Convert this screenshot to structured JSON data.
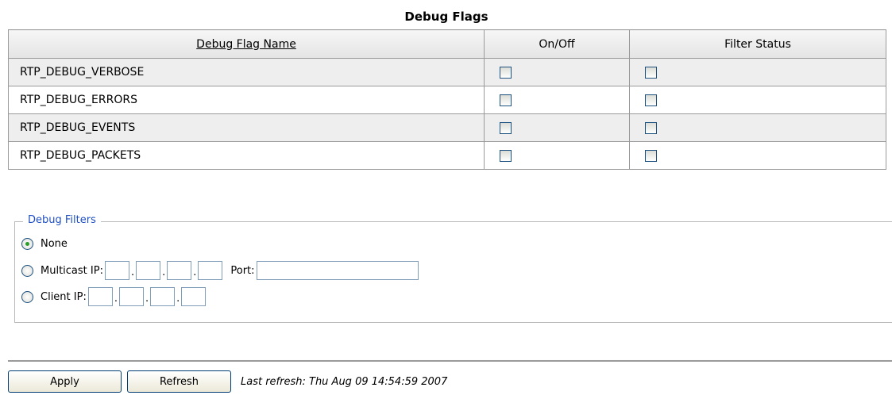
{
  "flags": {
    "title": "Debug Flags",
    "columns": [
      "Debug Flag Name",
      "On/Off",
      "Filter Status"
    ],
    "rows": [
      {
        "name": "RTP_DEBUG_VERBOSE",
        "on": false,
        "filter": false
      },
      {
        "name": "RTP_DEBUG_ERRORS",
        "on": false,
        "filter": false
      },
      {
        "name": "RTP_DEBUG_EVENTS",
        "on": false,
        "filter": false
      },
      {
        "name": "RTP_DEBUG_PACKETS",
        "on": false,
        "filter": false
      }
    ]
  },
  "filters": {
    "legend": "Debug Filters",
    "options": {
      "none": {
        "label": "None",
        "selected": true
      },
      "multicast": {
        "label": "Multicast IP:",
        "port_label": "Port:",
        "selected": false
      },
      "client": {
        "label": "Client IP:",
        "selected": false
      }
    },
    "octet_separator": "."
  },
  "actions": {
    "apply_label": "Apply",
    "refresh_label": "Refresh",
    "last_refresh": "Last refresh: Thu Aug 09 14:54:59 2007"
  },
  "colors": {
    "legend": "#1f4fc2",
    "radio_selected": "#2a9c2a",
    "row_shade": "#eeeeee"
  }
}
